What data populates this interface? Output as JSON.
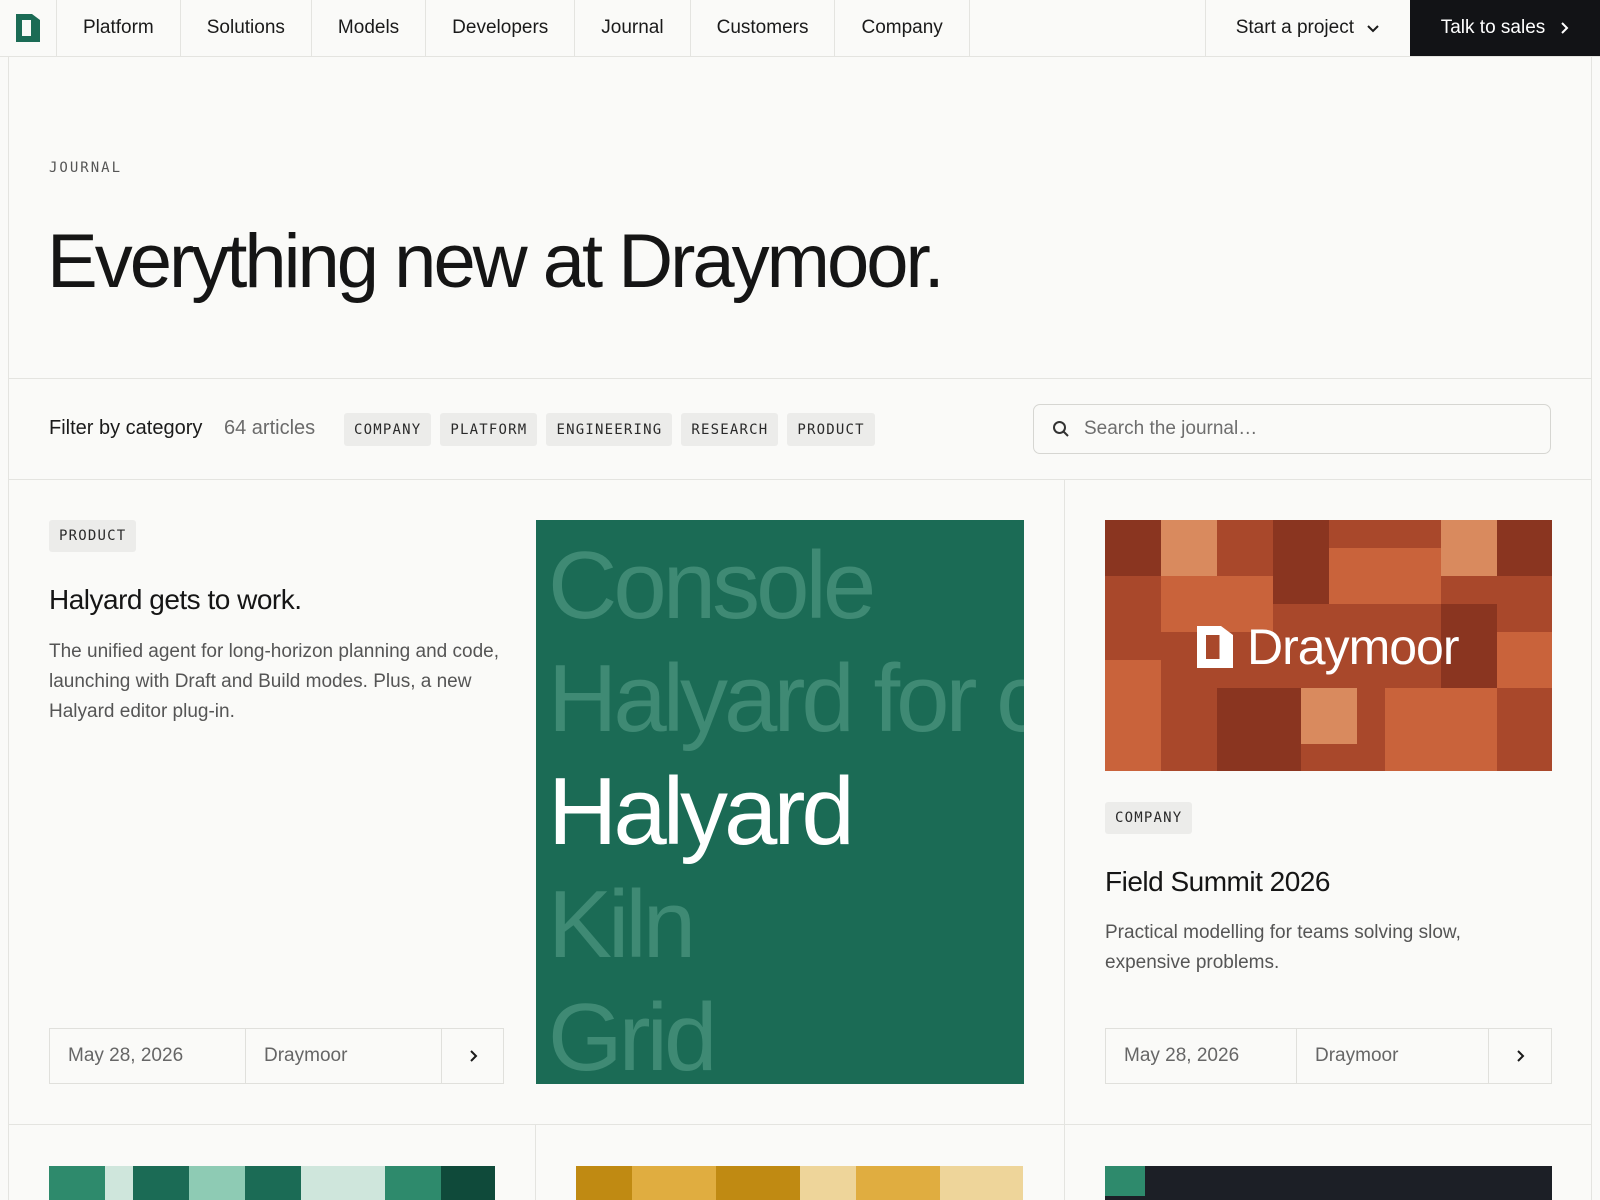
{
  "nav": {
    "items": [
      {
        "label": "Platform"
      },
      {
        "label": "Solutions"
      },
      {
        "label": "Models"
      },
      {
        "label": "Developers"
      },
      {
        "label": "Journal"
      },
      {
        "label": "Customers"
      },
      {
        "label": "Company"
      }
    ],
    "start_label": "Start a project",
    "sales_label": "Talk to sales"
  },
  "hero": {
    "eyebrow": "JOURNAL",
    "title": "Everything new at Draymoor."
  },
  "filter": {
    "label": "Filter by category",
    "count": "64 articles",
    "categories": [
      "COMPANY",
      "PLATFORM",
      "ENGINEERING",
      "RESEARCH",
      "PRODUCT"
    ],
    "search_placeholder": "Search the journal…"
  },
  "featured": {
    "tag": "PRODUCT",
    "title": "Halyard gets to work.",
    "description": "The unified agent for long-horizon planning and code, launching with Draft and Build modes. Plus, a new Halyard editor plug-in.",
    "date": "May 28, 2026",
    "author": "Draymoor",
    "image_words": [
      "Console",
      "Halyard for c",
      "Halyard",
      "Kiln",
      "Grid"
    ],
    "image_color": "#1b6b55"
  },
  "side_card": {
    "image_brand": "Draymoor",
    "tag": "COMPANY",
    "title": "Field Summit 2026",
    "description": "Practical modelling for teams solving slow, expensive problems.",
    "date": "May 28, 2026",
    "author": "Draymoor"
  },
  "colors": {
    "accent_green": "#1b6b55",
    "brand_rust": "#a9482b",
    "nav_dark": "#121316"
  }
}
